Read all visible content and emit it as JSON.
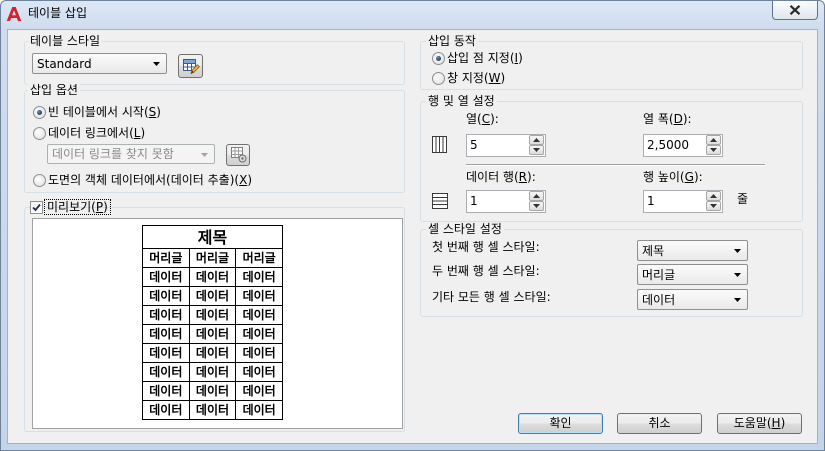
{
  "window": {
    "title": "테이블 삽입",
    "app_icon": "autocad-app-icon",
    "close_icon": "close-icon"
  },
  "colors": {
    "app_icon": "#d3222a",
    "default_button_border": "#3c7fb1"
  },
  "table_style": {
    "group_label": "테이블 스타일",
    "selected": "Standard",
    "launch_icon": "table-style-edit-icon"
  },
  "insert_options": {
    "group_label": "삽입 옵션",
    "options": [
      {
        "label": "빈 테이블에서 시작(S)",
        "selected": true
      },
      {
        "label": "데이터 링크에서(L)",
        "selected": false
      },
      {
        "label": "도면의 객체 데이터에서(데이터 추출)(X)",
        "selected": false
      }
    ],
    "data_link": {
      "selected": "데이터 링크를 찾지 못함",
      "enabled": false,
      "launch_icon": "data-link-manager-icon"
    }
  },
  "preview": {
    "label": "미리보기(P)",
    "checked": true,
    "table": {
      "title": "제목",
      "headers": [
        "머리글",
        "머리글",
        "머리글"
      ],
      "rows": [
        [
          "데이터",
          "데이터",
          "데이터"
        ],
        [
          "데이터",
          "데이터",
          "데이터"
        ],
        [
          "데이터",
          "데이터",
          "데이터"
        ],
        [
          "데이터",
          "데이터",
          "데이터"
        ],
        [
          "데이터",
          "데이터",
          "데이터"
        ],
        [
          "데이터",
          "데이터",
          "데이터"
        ],
        [
          "데이터",
          "데이터",
          "데이터"
        ],
        [
          "데이터",
          "데이터",
          "데이터"
        ]
      ]
    }
  },
  "insertion_behavior": {
    "group_label": "삽입 동작",
    "options": [
      {
        "label": "삽입 점 지정(I)",
        "selected": true
      },
      {
        "label": "창 지정(W)",
        "selected": false
      }
    ]
  },
  "rows_columns": {
    "group_label": "행 및 열 설정",
    "columns": {
      "label": "열(C):",
      "value": "5",
      "icon": "columns-icon"
    },
    "column_width": {
      "label": "열 폭(D):",
      "value": "2,5000"
    },
    "data_rows": {
      "label": "데이터 행(R):",
      "value": "1",
      "icon": "rows-icon"
    },
    "row_height": {
      "label": "행 높이(G):",
      "value": "1",
      "unit": "줄"
    }
  },
  "cell_styles": {
    "group_label": "셀 스타일 설정",
    "items": [
      {
        "label": "첫 번째 행 셀 스타일:",
        "value": "제목"
      },
      {
        "label": "두 번째 행 셀 스타일:",
        "value": "머리글"
      },
      {
        "label": "기타 모든 행 셀 스타일:",
        "value": "데이터"
      }
    ]
  },
  "buttons": {
    "ok": "확인",
    "cancel": "취소",
    "help": "도움말(H)"
  }
}
